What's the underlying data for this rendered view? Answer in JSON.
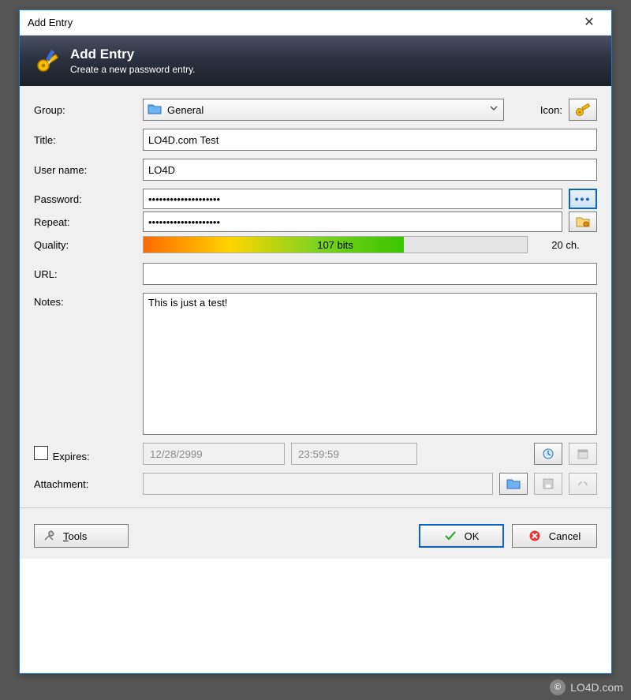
{
  "window": {
    "title": "Add Entry"
  },
  "header": {
    "title": "Add Entry",
    "subtitle": "Create a new password entry."
  },
  "labels": {
    "group": "Group:",
    "icon": "Icon:",
    "title": "Title:",
    "username": "User name:",
    "password": "Password:",
    "repeat": "Repeat:",
    "quality": "Quality:",
    "url": "URL:",
    "notes": "Notes:",
    "expires": "Expires:",
    "attachment": "Attachment:"
  },
  "fields": {
    "group": "General",
    "title": "LO4D.com Test",
    "username": "LO4D",
    "password": "••••••••••••••••••••",
    "repeat": "••••••••••••••••••••",
    "quality_text": "107 bits",
    "chars": "20 ch.",
    "url": "",
    "notes": "This is just a test!",
    "expires_date": "12/28/2999",
    "expires_time": "23:59:59",
    "attachment": ""
  },
  "buttons": {
    "tools": "Tools",
    "ok": "OK",
    "cancel": "Cancel"
  },
  "watermark": "LO4D.com"
}
